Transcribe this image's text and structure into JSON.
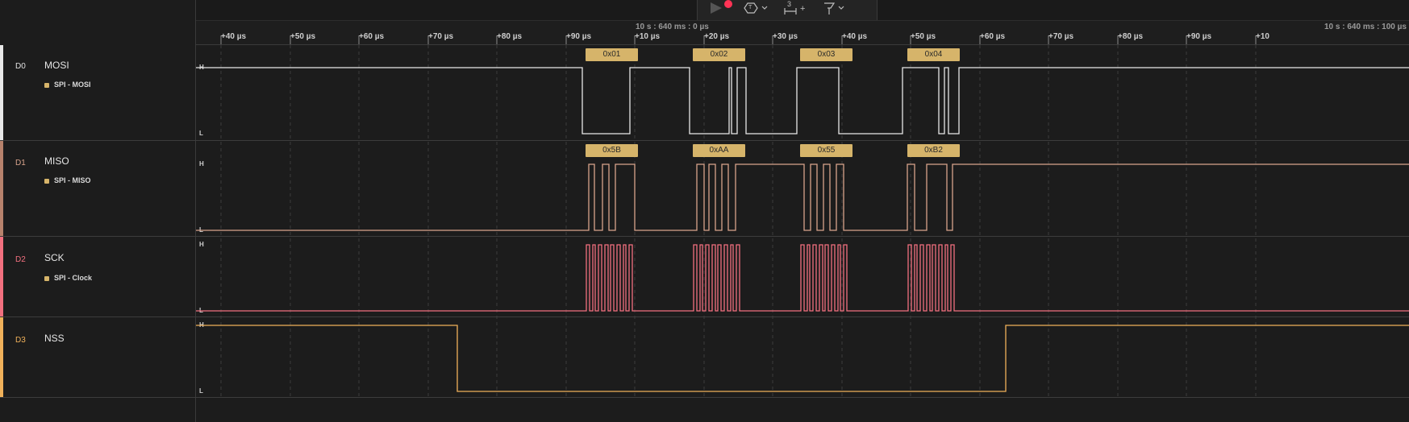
{
  "toolbar": {
    "play_icon": "play-icon",
    "record_icon": "record-dot-icon",
    "trigger_label": "T",
    "measure_label": "3",
    "measure_plus": "+",
    "marker_icon": "marker-flag-icon"
  },
  "ruler": {
    "ticks": [
      "+40 µs",
      "+50 µs",
      "+60 µs",
      "+70 µs",
      "+80 µs",
      "+90 µs",
      "+10 µs",
      "+20 µs",
      "+30 µs",
      "+40 µs",
      "+50 µs",
      "+60 µs",
      "+70 µs",
      "+80 µs",
      "+90 µs",
      "+10"
    ],
    "abs_labels": [
      "10 s : 640 ms : 0 µs",
      "10 s : 640 ms : 100 µs"
    ]
  },
  "level_labels": {
    "high": "H",
    "low": "L"
  },
  "channels": [
    {
      "index": "D0",
      "name": "MOSI",
      "analyzer": "SPI - MOSI",
      "color": "#e8e8e8",
      "bytes": [
        "0x01",
        "0x02",
        "0x03",
        "0x04"
      ]
    },
    {
      "index": "D1",
      "name": "MISO",
      "analyzer": "SPI - MISO",
      "color": "#d9a48c",
      "bytes": [
        "0x5B",
        "0xAA",
        "0x55",
        "0xB2"
      ]
    },
    {
      "index": "D2",
      "name": "SCK",
      "analyzer": "SPI - Clock",
      "color": "#f2707f",
      "bytes": []
    },
    {
      "index": "D3",
      "name": "NSS",
      "analyzer": "",
      "color": "#f0b15a",
      "bytes": []
    }
  ],
  "colors": {
    "annotation_bg": "#d6b46a",
    "annotation_text": "#2a2a2a",
    "grid": "#3a3a3a",
    "accent_record": "#ff3355"
  }
}
